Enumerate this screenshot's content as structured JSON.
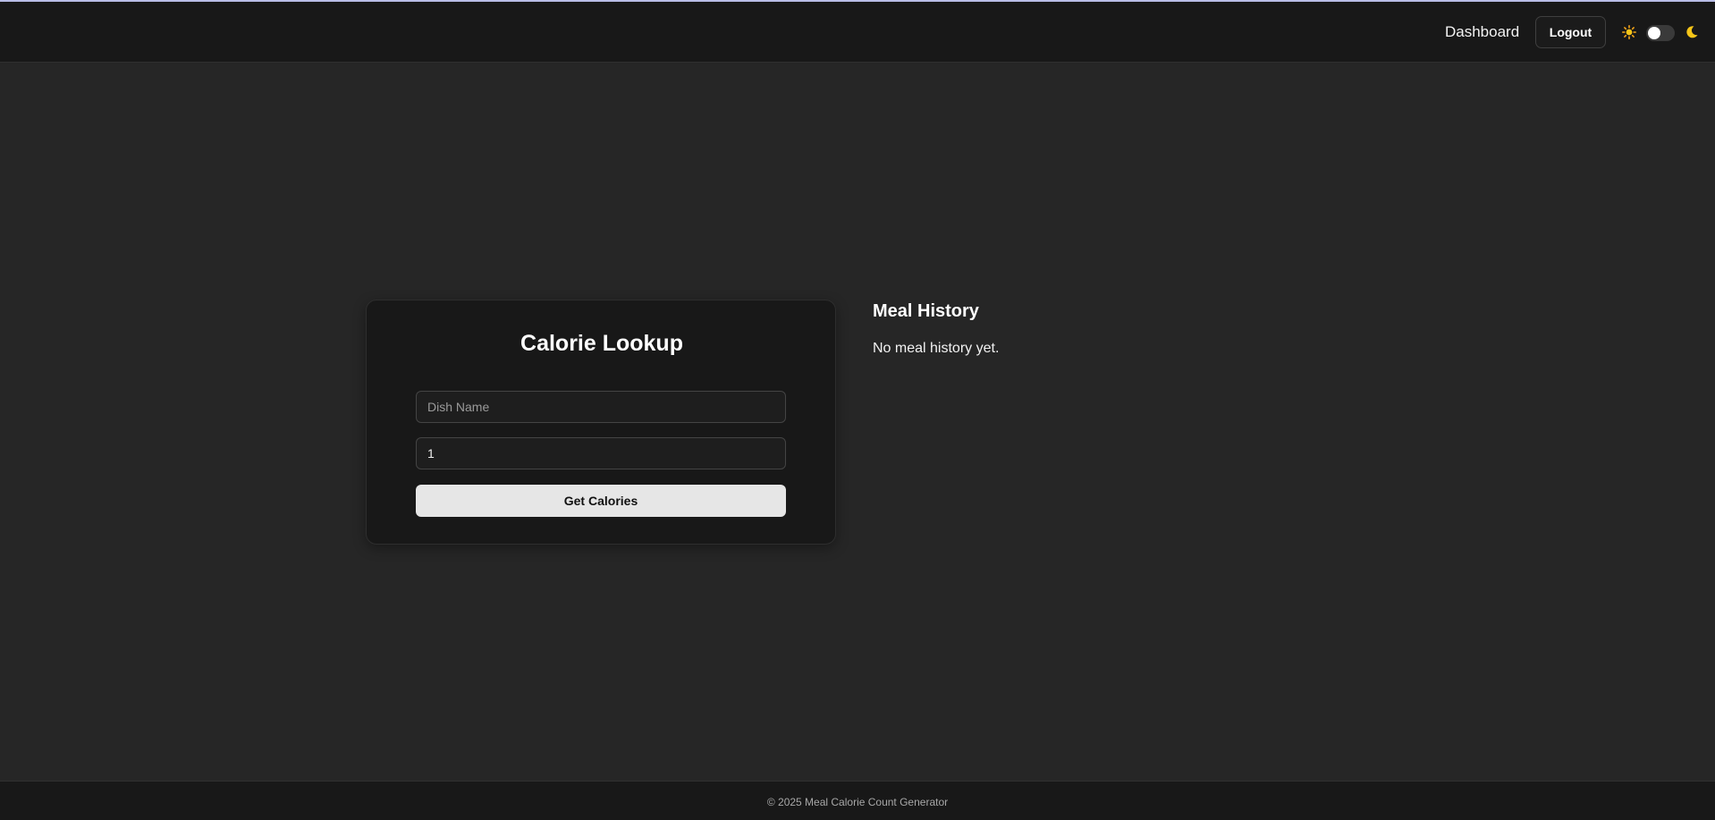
{
  "nav": {
    "dashboard_label": "Dashboard",
    "logout_label": "Logout",
    "theme_toggle": {
      "light_icon": "sun-icon",
      "dark_icon": "moon-icon",
      "enabled": false
    }
  },
  "lookup_card": {
    "title": "Calorie Lookup",
    "dish_placeholder": "Dish Name",
    "dish_value": "",
    "quantity_value": "1",
    "submit_label": "Get Calories"
  },
  "meal_history": {
    "title": "Meal History",
    "empty_text": "No meal history yet."
  },
  "footer": {
    "text": "© 2025 Meal Calorie Count Generator"
  },
  "colors": {
    "page_bg": "#262626",
    "nav_bg": "#181818",
    "card_bg": "#181818",
    "accent_sun": "#f5c518",
    "button_bg": "#e6e6e6"
  }
}
